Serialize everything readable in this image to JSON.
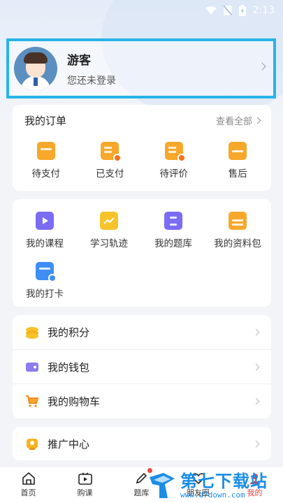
{
  "status_bar": {
    "time": "2:13"
  },
  "profile": {
    "name": "游客",
    "subtitle": "您还未登录"
  },
  "orders": {
    "title": "我的订单",
    "view_all": "查看全部",
    "items": [
      {
        "label": "待支付",
        "icon": "wallet-icon"
      },
      {
        "label": "已支付",
        "icon": "paid-doc-icon"
      },
      {
        "label": "待评价",
        "icon": "review-icon"
      },
      {
        "label": "售后",
        "icon": "return-icon"
      }
    ]
  },
  "tools": {
    "items": [
      {
        "label": "我的课程",
        "icon": "course-play-icon"
      },
      {
        "label": "学习轨迹",
        "icon": "trend-icon"
      },
      {
        "label": "我的题库",
        "icon": "question-bank-icon"
      },
      {
        "label": "我的资料包",
        "icon": "folder-icon"
      },
      {
        "label": "我的打卡",
        "icon": "calendar-check-icon"
      }
    ]
  },
  "list": {
    "items": [
      {
        "label": "我的积分",
        "icon": "coins-icon"
      },
      {
        "label": "我的钱包",
        "icon": "purse-icon"
      },
      {
        "label": "我的购物车",
        "icon": "cart-icon"
      }
    ]
  },
  "promo": {
    "label": "推广中心",
    "icon": "promo-icon"
  },
  "tabbar": {
    "items": [
      {
        "label": "首页",
        "icon": "home-icon"
      },
      {
        "label": "购课",
        "icon": "video-icon"
      },
      {
        "label": "题库",
        "icon": "pencil-icon"
      },
      {
        "label": "朋友圈",
        "icon": "heart-icon"
      },
      {
        "label": "我的",
        "icon": "user-icon"
      }
    ]
  },
  "watermark": {
    "title": "第七下载站",
    "url": "www.d7down.com"
  },
  "colors": {
    "accent": "#27b4e8",
    "orange": "#f7a82a",
    "purple": "#7b6cf5",
    "active_tab": "#e23d3d",
    "watermark": "#1b8de6"
  }
}
